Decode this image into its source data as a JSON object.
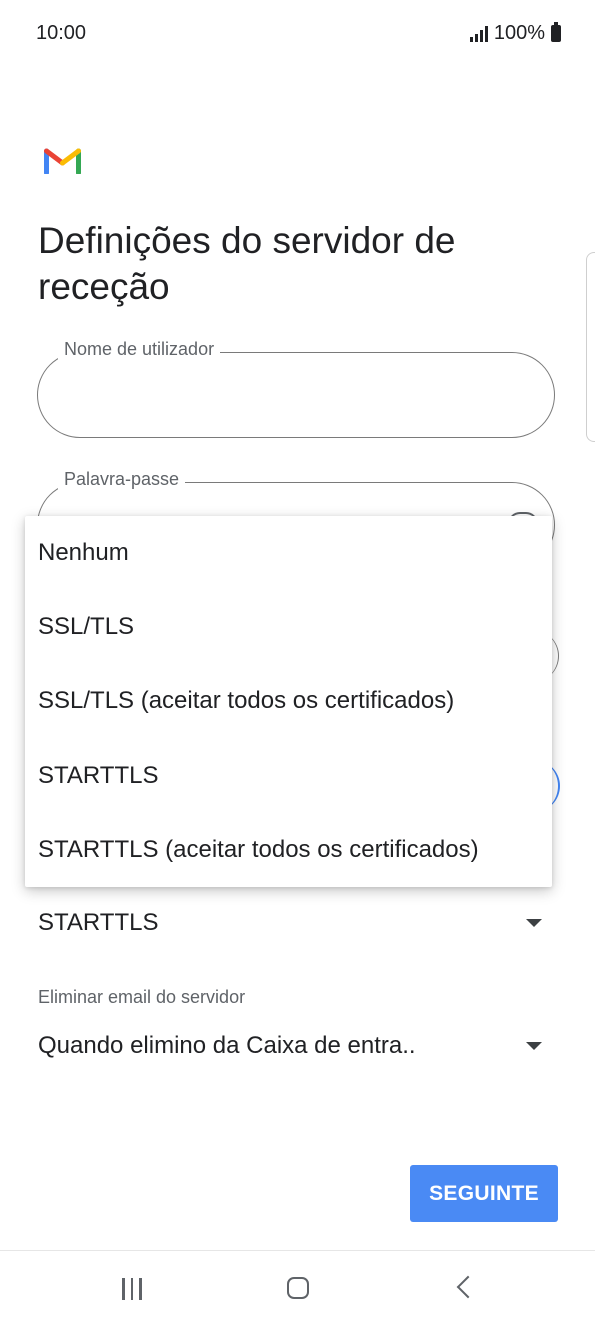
{
  "status_bar": {
    "time": "10:00",
    "battery_text": "100%"
  },
  "icons": {
    "app_logo": "gmail-logo",
    "signal": "signal-icon",
    "battery": "battery-icon",
    "eye": "eye-icon"
  },
  "page": {
    "title": "Definições do servidor de receção"
  },
  "form": {
    "username": {
      "label": "Nome de utilizador",
      "value": ""
    },
    "password": {
      "label": "Palavra-passe",
      "value": ""
    },
    "security_type": {
      "selected": "STARTTLS"
    },
    "delete_email": {
      "label": "Eliminar email do servidor",
      "selected": "Quando elimino da Caixa de entra.."
    }
  },
  "dropdown": {
    "options": [
      "Nenhum",
      "SSL/TLS",
      "SSL/TLS (aceitar todos os certificados)",
      "STARTTLS",
      "STARTTLS (aceitar todos os certificados)"
    ]
  },
  "actions": {
    "next_label": "SEGUINTE"
  },
  "colors": {
    "accent": "#4A8AF4",
    "text": "#202124",
    "secondary_text": "#5F6368"
  }
}
